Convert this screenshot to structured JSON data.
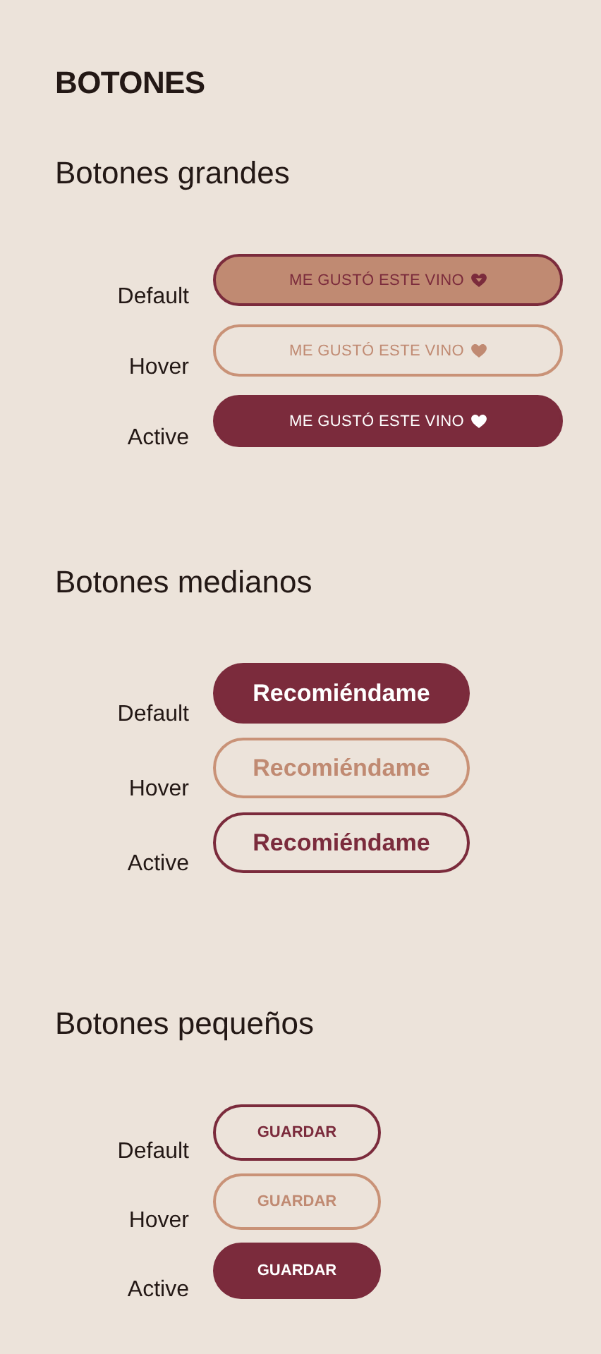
{
  "heading": "BOTONES",
  "sections": [
    {
      "title": "Botones grandes",
      "kind": "large",
      "rows": [
        {
          "label": "Default",
          "button": {
            "text": "ME GUSTÓ ESTE VINO",
            "kind": "filled-light",
            "heart": true
          }
        },
        {
          "label": "Hover",
          "button": {
            "text": "ME GUSTÓ ESTE VINO",
            "kind": "outline-light",
            "heart": true
          }
        },
        {
          "label": "Active",
          "button": {
            "text": "ME GUSTÓ ESTE VINO",
            "kind": "filled-dark",
            "heart": true
          }
        }
      ]
    },
    {
      "title": "Botones medianos",
      "kind": "medium",
      "rows": [
        {
          "label": "Default",
          "button": {
            "text": "Recomiéndame",
            "kind": "filled-dark",
            "heart": false
          }
        },
        {
          "label": "Hover",
          "button": {
            "text": "Recomiéndame",
            "kind": "outline-light",
            "heart": false
          }
        },
        {
          "label": "Active",
          "button": {
            "text": "Recomiéndame",
            "kind": "outline-dark",
            "heart": false
          }
        }
      ]
    },
    {
      "title": "Botones pequeños",
      "kind": "small",
      "rows": [
        {
          "label": "Default",
          "button": {
            "text": "GUARDAR",
            "kind": "outline-dark",
            "heart": false
          }
        },
        {
          "label": "Hover",
          "button": {
            "text": "GUARDAR",
            "kind": "outline-light",
            "heart": false
          }
        },
        {
          "label": "Active",
          "button": {
            "text": "GUARDAR",
            "kind": "filled-dark",
            "heart": false
          }
        }
      ]
    }
  ]
}
